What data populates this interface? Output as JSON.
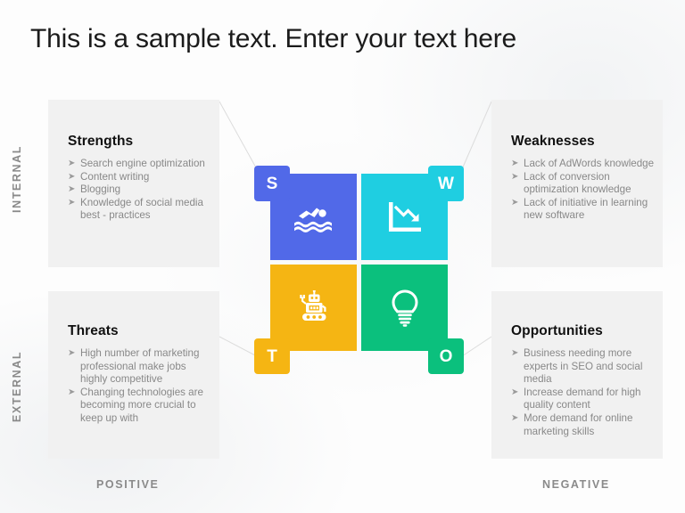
{
  "slide": {
    "title": "This is a sample text. Enter your text here",
    "background_color": "#fdfdfd"
  },
  "axes": {
    "vertical_top": "INTERNAL",
    "vertical_bottom": "EXTERNAL",
    "horizontal_left": "POSITIVE",
    "horizontal_right": "NEGATIVE"
  },
  "quadrants": [
    {
      "key": "strengths",
      "letter": "S",
      "heading": "Strengths",
      "color": "#5169e8",
      "badge_color": "#5169e8",
      "icon": "swimmer-icon",
      "bullets": [
        "Search engine optimization",
        "Content writing",
        "Blogging",
        "Knowledge of social media best - practices"
      ]
    },
    {
      "key": "weaknesses",
      "letter": "W",
      "heading": "Weaknesses",
      "color": "#1fcee1",
      "badge_color": "#1fcee1",
      "icon": "declining-chart-icon",
      "bullets": [
        "Lack of AdWords knowledge",
        "Lack of conversion optimization knowledge",
        "Lack of initiative in learning new software"
      ]
    },
    {
      "key": "threats",
      "letter": "T",
      "heading": "Threats",
      "color": "#f5b513",
      "badge_color": "#f5b513",
      "icon": "robot-icon",
      "bullets": [
        "High number of marketing professional make jobs highly competitive",
        "Changing technologies are becoming more crucial to keep up with"
      ]
    },
    {
      "key": "opportunities",
      "letter": "O",
      "heading": "Opportunities",
      "color": "#0bc07d",
      "badge_color": "#0bc07d",
      "icon": "lightbulb-icon",
      "bullets": [
        "Business needing more experts in SEO and social media",
        "Increase demand for high quality content",
        "More demand for online marketing skills"
      ]
    }
  ],
  "bullet_marker": "➤"
}
